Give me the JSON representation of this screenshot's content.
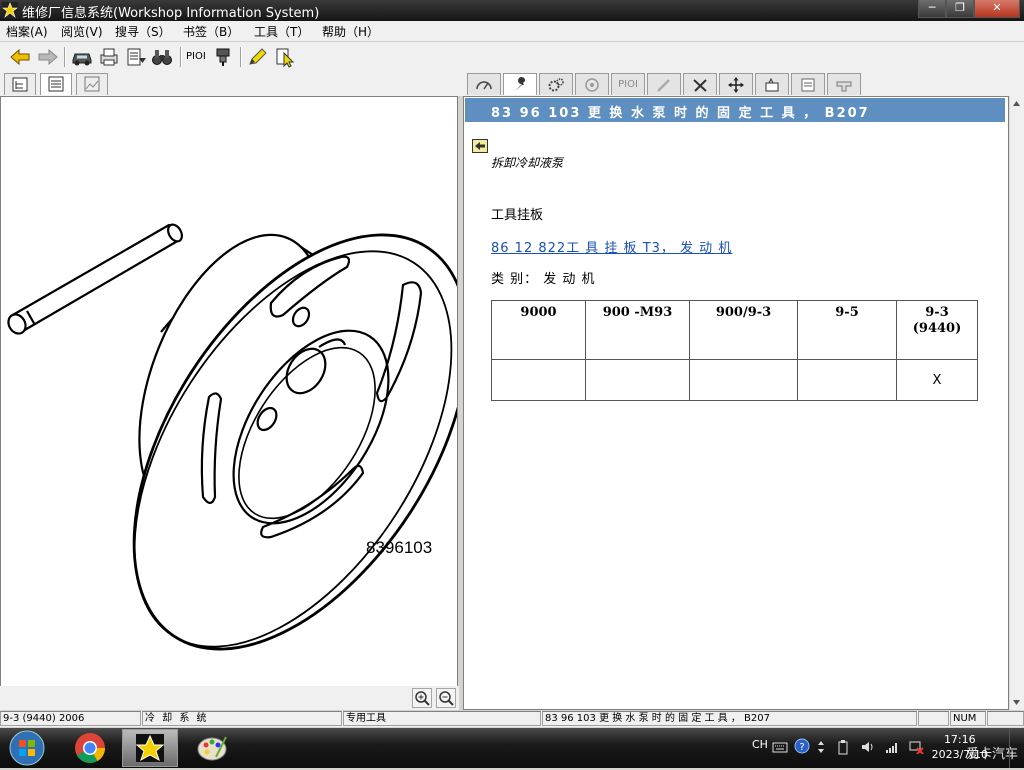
{
  "window": {
    "title": "维修厂信息系统(Workshop Information System)"
  },
  "menu": [
    "档案(A)",
    "阅览(V)",
    "搜寻（S）",
    "书签（B）",
    "工具（T）",
    "帮助（H）"
  ],
  "toolbar": {
    "pioi_label": "PIOI"
  },
  "right_tabs": {
    "pioi_label": "PIOI"
  },
  "drawing": {
    "part_number": "8396103"
  },
  "doc": {
    "header": "83 96 103 更 换 水 泵 时 的 固 定 工 具 ， B207",
    "subtitle": "拆卸冷却液泵",
    "tool_board_label": "工具挂板",
    "tool_link": "86 12 822工 具 挂 板 T3， 发 动 机",
    "category": "类 别： 发 动 机",
    "table": {
      "headers": [
        "9000",
        "900 -M93",
        "900/9-3",
        "9-5",
        "9-3\n(9440)"
      ],
      "row": [
        "",
        "",
        "",
        "",
        "X"
      ]
    }
  },
  "status": {
    "model": "9-3 (9440) 2006",
    "system": "冷 却 系 统",
    "type": "专用工具",
    "doc": "83 96 103 更 换 水 泵 时 的 固 定 工 具 ， B207",
    "num": "NUM"
  },
  "taskbar": {
    "lang": "CH",
    "time": "17:16",
    "date": "2023/7/10",
    "watermark": "爱卡汽车"
  },
  "colors": {
    "header_bg": "#5e8fc0",
    "link": "#1a4fb6",
    "titlebar": "#151515"
  }
}
